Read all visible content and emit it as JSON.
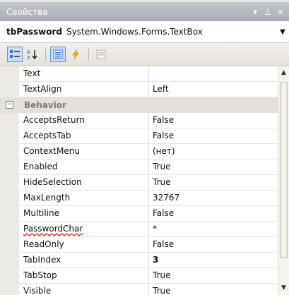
{
  "window": {
    "title": "Свойства",
    "pin_glyph": "⊥",
    "close_glyph": "×"
  },
  "object_selector": {
    "name": "tbPassword",
    "type": "System.Windows.Forms.TextBox"
  },
  "toolbar": {
    "sort_alpha_label": "A↓Z"
  },
  "grid": {
    "rows": [
      {
        "kind": "prop",
        "name": "Text",
        "value": ""
      },
      {
        "kind": "prop",
        "name": "TextAlign",
        "value": "Left"
      },
      {
        "kind": "category",
        "name": "Behavior",
        "expander": "−"
      },
      {
        "kind": "prop",
        "name": "AcceptsReturn",
        "value": "False"
      },
      {
        "kind": "prop",
        "name": "AcceptsTab",
        "value": "False"
      },
      {
        "kind": "prop",
        "name": "ContextMenu",
        "value": "(нет)"
      },
      {
        "kind": "prop",
        "name": "Enabled",
        "value": "True"
      },
      {
        "kind": "prop",
        "name": "HideSelection",
        "value": "True"
      },
      {
        "kind": "prop",
        "name": "MaxLength",
        "value": "32767"
      },
      {
        "kind": "prop",
        "name": "Multiline",
        "value": "False"
      },
      {
        "kind": "prop",
        "name": "PasswordChar",
        "value": "*"
      },
      {
        "kind": "prop",
        "name": "ReadOnly",
        "value": "False"
      },
      {
        "kind": "prop",
        "name": "TabIndex",
        "value": "3"
      },
      {
        "kind": "prop",
        "name": "TabStop",
        "value": "True"
      },
      {
        "kind": "prop",
        "name": "Visible",
        "value": "True"
      }
    ]
  },
  "scrollbar": {
    "up_glyph": "▲",
    "down_glyph": "▼"
  },
  "colors": {
    "titlebar": "#b3b7be",
    "category_bg": "#e3e1da",
    "category_text": "#7d7a73",
    "squiggle": "#dd1111"
  }
}
